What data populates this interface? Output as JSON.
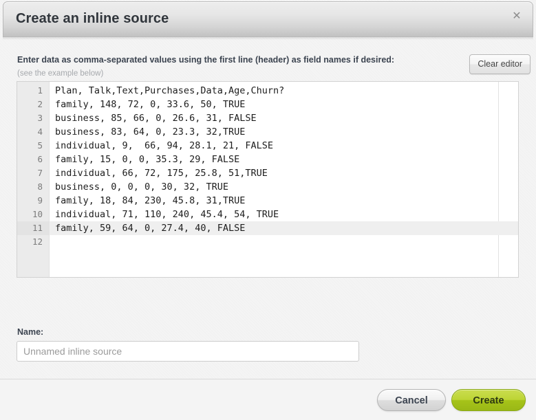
{
  "dialog": {
    "title": "Create an inline source",
    "close_icon": "close-icon",
    "close_glyph": "✕"
  },
  "instructions": {
    "main": "Enter data as comma-separated values using the first line (header) as field names if desired:",
    "sub": "(see the example below)"
  },
  "toolbar": {
    "clear_editor_label": "Clear editor"
  },
  "editor": {
    "active_line": 11,
    "lines": [
      {
        "number": "1",
        "text": "Plan, Talk,Text,Purchases,Data,Age,Churn?"
      },
      {
        "number": "2",
        "text": "family, 148, 72, 0, 33.6, 50, TRUE"
      },
      {
        "number": "3",
        "text": "business, 85, 66, 0, 26.6, 31, FALSE"
      },
      {
        "number": "4",
        "text": "business, 83, 64, 0, 23.3, 32,TRUE"
      },
      {
        "number": "5",
        "text": "individual, 9,  66, 94, 28.1, 21, FALSE"
      },
      {
        "number": "6",
        "text": "family, 15, 0, 0, 35.3, 29, FALSE"
      },
      {
        "number": "7",
        "text": "individual, 66, 72, 175, 25.8, 51,TRUE"
      },
      {
        "number": "8",
        "text": "business, 0, 0, 0, 30, 32, TRUE"
      },
      {
        "number": "9",
        "text": "family, 18, 84, 230, 45.8, 31,TRUE"
      },
      {
        "number": "10",
        "text": "individual, 71, 110, 240, 45.4, 54, TRUE"
      },
      {
        "number": "11",
        "text": "family, 59, 64, 0, 27.4, 40, FALSE"
      },
      {
        "number": "12",
        "text": ""
      }
    ]
  },
  "name_field": {
    "label": "Name:",
    "value": "",
    "placeholder": "Unnamed inline source"
  },
  "footer": {
    "cancel_label": "Cancel",
    "create_label": "Create"
  },
  "colors": {
    "accent_create": "#bdd435",
    "title_text": "#31363c",
    "muted_text": "#a6a9ad",
    "editor_background": "#ffffff",
    "gutter_background": "#ebebeb",
    "active_line_background": "#efefef"
  }
}
